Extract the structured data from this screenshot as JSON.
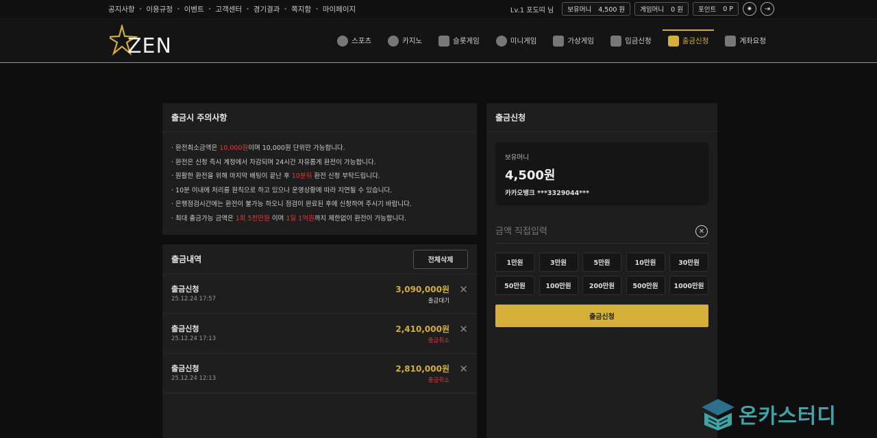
{
  "topbar": {
    "links": [
      "공지사항",
      "이용규정",
      "이벤트",
      "고객센터",
      "경기결과",
      "쪽지함",
      "마이페이지"
    ],
    "level": "Lv.1",
    "user": "포도띠 님",
    "money_label": "보유머니",
    "money_value": "4,500 원",
    "game_money_label": "게임머니",
    "game_money_value": "0 원",
    "point_label": "포인트",
    "point_value": "0 P"
  },
  "nav": {
    "logo_text": "ZEN",
    "items": [
      {
        "label": "스포츠",
        "icon": "soccer-icon"
      },
      {
        "label": "카지노",
        "icon": "chip-icon"
      },
      {
        "label": "슬롯게임",
        "icon": "slot-icon"
      },
      {
        "label": "미니게임",
        "icon": "mini-game-icon"
      },
      {
        "label": "가상게임",
        "icon": "virtual-game-icon"
      },
      {
        "label": "입금신청",
        "icon": "deposit-icon"
      },
      {
        "label": "출금신청",
        "icon": "withdraw-icon",
        "active": true
      },
      {
        "label": "계좌요청",
        "icon": "bank-icon"
      }
    ]
  },
  "notice": {
    "title": "출금시 주의사항"
  },
  "history": {
    "title": "출금내역",
    "delete_all": "전체삭제",
    "rows": [
      {
        "title": "출금신청",
        "date": "25.12.24 17:57",
        "amount": "3,090,000원",
        "status": "출금대기",
        "status_color": "#dddddd"
      },
      {
        "title": "출금신청",
        "date": "25.12.24 17:13",
        "amount": "2,410,000원",
        "status": "출금취소",
        "status_color": "#e23b3b"
      },
      {
        "title": "출금신청",
        "date": "25.12.24 12:13",
        "amount": "2,810,000원",
        "status": "출금취소",
        "status_color": "#e23b3b"
      }
    ]
  },
  "request": {
    "title": "출금신청",
    "balance_label": "보유머니",
    "balance_value": "4,500원",
    "bank": "카카오뱅크 ***3329044***",
    "amount_placeholder": "금액 직접입력",
    "amount_buttons": [
      "1만원",
      "3만원",
      "5만원",
      "10만원",
      "30만원",
      "50만원",
      "100만원",
      "200만원",
      "500만원",
      "1000만원"
    ],
    "submit_label": "출금신청"
  },
  "watermark": {
    "text": "온카스터디"
  },
  "colors": {
    "accent": "#d4af3a",
    "danger": "#e23b3b"
  }
}
